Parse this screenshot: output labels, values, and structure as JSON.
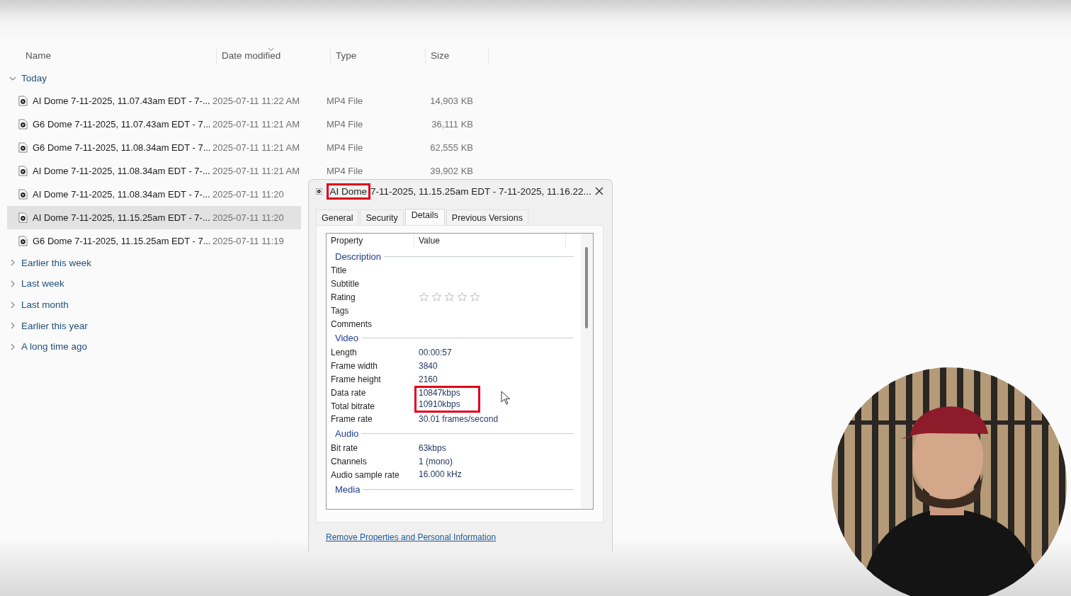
{
  "explorer": {
    "columns": [
      {
        "label": "Name",
        "sorted": false
      },
      {
        "label": "Date modified",
        "sorted": true
      },
      {
        "label": "Type",
        "sorted": false
      },
      {
        "label": "Size",
        "sorted": false
      }
    ],
    "groups": [
      {
        "label": "Today",
        "expanded": true,
        "files": [
          {
            "name": "AI Dome 7-11-2025, 11.07.43am EDT - 7-...",
            "date": "2025-07-11 11:22 AM",
            "type": "MP4 File",
            "size": "14,903 KB",
            "selected": false
          },
          {
            "name": "G6 Dome 7-11-2025, 11.07.43am EDT - 7...",
            "date": "2025-07-11 11:21 AM",
            "type": "MP4 File",
            "size": "36,111 KB",
            "selected": false
          },
          {
            "name": "G6 Dome 7-11-2025, 11.08.34am EDT - 7...",
            "date": "2025-07-11 11:21 AM",
            "type": "MP4 File",
            "size": "62,555 KB",
            "selected": false
          },
          {
            "name": "AI Dome 7-11-2025, 11.08.34am EDT - 7-...",
            "date": "2025-07-11 11:21 AM",
            "type": "MP4 File",
            "size": "39,902 KB",
            "selected": false
          },
          {
            "name": "AI Dome 7-11-2025, 11.08.34am EDT - 7-...",
            "date": "2025-07-11 11:20",
            "selected": false
          },
          {
            "name": "AI Dome 7-11-2025, 11.15.25am EDT - 7-...",
            "date": "2025-07-11 11:20",
            "selected": true
          },
          {
            "name": "G6 Dome 7-11-2025, 11.15.25am EDT - 7...",
            "date": "2025-07-11 11:19",
            "selected": false
          }
        ]
      },
      {
        "label": "Earlier this week",
        "expanded": false
      },
      {
        "label": "Last week",
        "expanded": false
      },
      {
        "label": "Last month",
        "expanded": false
      },
      {
        "label": "Earlier this year",
        "expanded": false
      },
      {
        "label": "A long time ago",
        "expanded": false
      }
    ]
  },
  "dialog": {
    "title": [
      {
        "text": "AI Dome",
        "highlighted": true
      },
      {
        "text": "7-11-2025, 11.15.25am EDT - 7-11-2025, 11.16.22...",
        "highlighted": false
      }
    ],
    "tabs": [
      {
        "label": "General",
        "selected": false
      },
      {
        "label": "Security",
        "selected": false
      },
      {
        "label": "Details",
        "selected": true
      },
      {
        "label": "Previous Versions",
        "selected": false
      }
    ],
    "columns": [
      "Property",
      "Value"
    ],
    "sections": [
      {
        "heading": "Description",
        "rows": [
          {
            "kind": "text",
            "property": "Title"
          },
          {
            "kind": "text",
            "property": "Subtitle"
          },
          {
            "kind": "stars",
            "property": "Rating",
            "stars": 0
          },
          {
            "kind": "text",
            "property": "Tags"
          },
          {
            "kind": "text",
            "property": "Comments"
          }
        ]
      },
      {
        "heading": "Video",
        "rows": [
          {
            "kind": "text",
            "property": "Length",
            "value": "00:00:57",
            "highlighted": false
          },
          {
            "kind": "text",
            "property": "Frame width",
            "value": "3840",
            "highlighted": false
          },
          {
            "kind": "text",
            "property": "Frame height",
            "value": "2160",
            "highlighted": false
          },
          {
            "kind": "text",
            "property": "Data rate",
            "value": "10847kbps",
            "highlighted": true
          },
          {
            "kind": "text",
            "property": "Total bitrate",
            "value": "10910kbps",
            "highlighted": true
          },
          {
            "kind": "text",
            "property": "Frame rate",
            "value": "30.01 frames/second",
            "highlighted": false
          }
        ]
      },
      {
        "heading": "Audio",
        "rows": [
          {
            "kind": "text",
            "property": "Bit rate",
            "value": "63kbps",
            "highlighted": false
          },
          {
            "kind": "text",
            "property": "Channels",
            "value": "1 (mono)",
            "highlighted": false
          },
          {
            "kind": "text",
            "property": "Audio sample rate",
            "value": "16.000 kHz",
            "highlighted": false
          }
        ]
      },
      {
        "heading": "Media"
      }
    ],
    "link": "Remove Properties and Personal Information"
  }
}
